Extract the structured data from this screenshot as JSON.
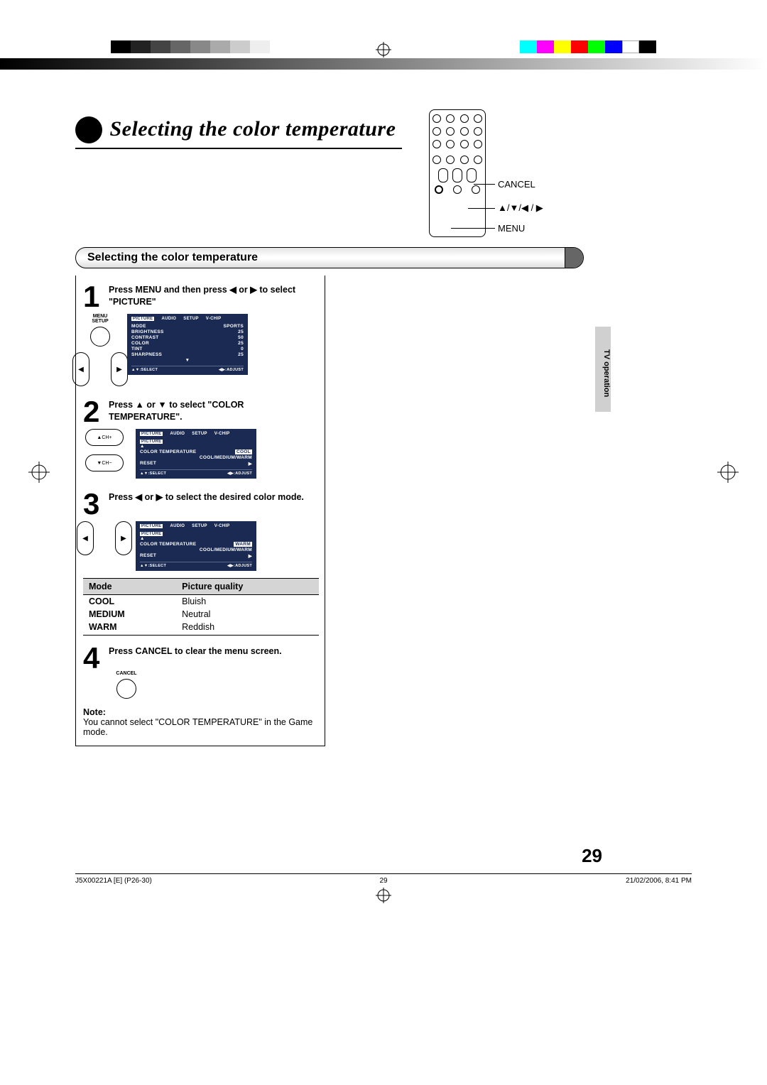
{
  "title": "Selecting the color temperature",
  "section_header": "Selecting the color temperature",
  "remote_labels": {
    "cancel": "CANCEL",
    "arrows": "▲/▼/◀ / ▶",
    "menu": "MENU"
  },
  "steps": {
    "s1": {
      "num": "1",
      "text_a": "Press MENU and then press ",
      "text_b": " or ",
      "text_c": " to select \"PICTURE\"",
      "btn_label_a": "MENU",
      "btn_label_b": "SETUP"
    },
    "s2": {
      "num": "2",
      "text_a": "Press ",
      "text_b": " or ",
      "text_c": " to select \"COLOR TEMPERATURE\".",
      "btn_up": "▲CH+",
      "btn_down": "▼CH−"
    },
    "s3": {
      "num": "3",
      "text_a": "Press ",
      "text_b": " or ",
      "text_c": " to select the desired color mode."
    },
    "s4": {
      "num": "4",
      "text": "Press CANCEL to clear the menu screen.",
      "btn_label": "CANCEL"
    }
  },
  "osd": {
    "tabs": [
      "PICTURE",
      "AUDIO",
      "SETUP",
      "V-CHIP"
    ],
    "screen1": {
      "rows": [
        [
          "MODE",
          "SPORTS"
        ],
        [
          "BRIGHTNESS",
          "25"
        ],
        [
          "CONTRAST",
          "50"
        ],
        [
          "COLOR",
          "25"
        ],
        [
          "TINT",
          "0"
        ],
        [
          "SHARPNESS",
          "25"
        ]
      ],
      "down": "▼"
    },
    "screen2": {
      "section": "PICTURE",
      "up": "▲",
      "rows": [
        [
          "COLOR TEMPERATURE",
          "COOL"
        ],
        [
          "",
          "COOL/MEDIUM/WARM"
        ],
        [
          "RESET",
          "▶"
        ]
      ]
    },
    "screen3": {
      "section": "PICTURE",
      "up": "▲",
      "rows": [
        [
          "COLOR TEMPERATURE",
          "WARM"
        ],
        [
          "",
          "COOL/MEDIUM/WARM"
        ],
        [
          "RESET",
          "▶"
        ]
      ]
    },
    "footer_select": "▲▼:SELECT",
    "footer_adjust": "◀▶:ADJUST"
  },
  "mode_table": {
    "headers": [
      "Mode",
      "Picture quality"
    ],
    "rows": [
      [
        "COOL",
        "Bluish"
      ],
      [
        "MEDIUM",
        "Neutral"
      ],
      [
        "WARM",
        "Reddish"
      ]
    ]
  },
  "note": {
    "label": "Note:",
    "body": "You cannot select \"COLOR TEMPERATURE\" in the Game mode."
  },
  "side_tab": "TV operation",
  "page_number": "29",
  "footer": {
    "left": "J5X00221A [E] (P26-30)",
    "center": "29",
    "right": "21/02/2006, 8:41 PM"
  },
  "glyphs": {
    "left": "◀",
    "right": "▶",
    "up": "▲",
    "down": "▼"
  }
}
